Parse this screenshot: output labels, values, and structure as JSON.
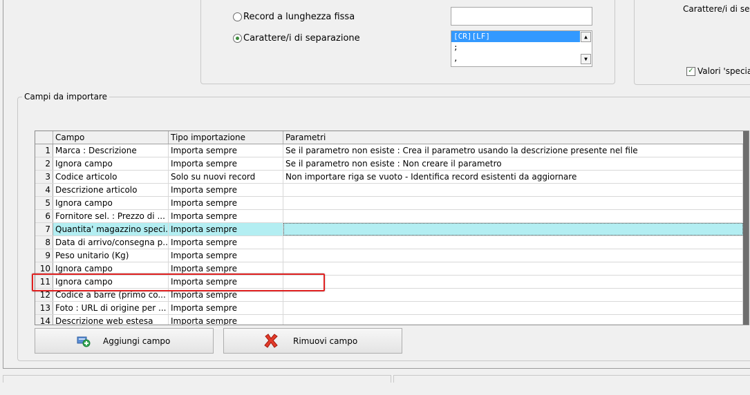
{
  "record_type": {
    "options": [
      {
        "label": "Record a lunghezza fissa",
        "selected": false
      },
      {
        "label": "Carattere/i di separazione",
        "selected": true
      }
    ],
    "fixed_length_value": "",
    "separator_list": [
      "[CR][LF]",
      ";",
      ","
    ]
  },
  "right_panel": {
    "separator_label": "Carattere/i di sep",
    "special_values_label": "Valori 'specia",
    "special_values_checked": true
  },
  "fields_group": {
    "title": "Campi da importare",
    "columns": [
      "Campo",
      "Tipo importazione",
      "Parametri"
    ],
    "rows": [
      {
        "n": "1",
        "campo": "Marca : Descrizione",
        "tipo": "Importa sempre",
        "parametri": "Se il parametro non esiste : Crea il parametro usando la descrizione presente nel file"
      },
      {
        "n": "2",
        "campo": "Ignora campo",
        "tipo": "Importa sempre",
        "parametri": "Se il parametro non esiste : Non creare il parametro"
      },
      {
        "n": "3",
        "campo": "Codice articolo",
        "tipo": "Solo su nuovi record",
        "parametri": "Non importare riga se vuoto - Identifica record esistenti da aggiornare"
      },
      {
        "n": "4",
        "campo": "Descrizione articolo",
        "tipo": "Importa sempre",
        "parametri": ""
      },
      {
        "n": "5",
        "campo": "Ignora campo",
        "tipo": "Importa sempre",
        "parametri": ""
      },
      {
        "n": "6",
        "campo": "Fornitore sel. : Prezzo di ...",
        "tipo": "Importa sempre",
        "parametri": ""
      },
      {
        "n": "7",
        "campo": "Quantita' magazzino speci...",
        "tipo": "Importa sempre",
        "parametri": ""
      },
      {
        "n": "8",
        "campo": "Data di arrivo/consegna p...",
        "tipo": "Importa sempre",
        "parametri": ""
      },
      {
        "n": "9",
        "campo": "Peso unitario (Kg)",
        "tipo": "Importa sempre",
        "parametri": ""
      },
      {
        "n": "10",
        "campo": "Ignora campo",
        "tipo": "Importa sempre",
        "parametri": ""
      },
      {
        "n": "11",
        "campo": "Ignora campo",
        "tipo": "Importa sempre",
        "parametri": ""
      },
      {
        "n": "12",
        "campo": "Codice a barre (primo co...",
        "tipo": "Importa sempre",
        "parametri": ""
      },
      {
        "n": "13",
        "campo": "Foto : URL di origine per ...",
        "tipo": "Importa sempre",
        "parametri": ""
      },
      {
        "n": "14",
        "campo": "Descrizione web estesa",
        "tipo": "Importa sempre",
        "parametri": ""
      }
    ],
    "selected_row": "7",
    "highlighted_row": "11",
    "highlight_color": "#e02020"
  },
  "buttons": {
    "add": {
      "label": "Aggiungi campo",
      "icon": "add-field-icon"
    },
    "remove": {
      "label": "Rimuovi campo",
      "icon": "red-x-icon"
    }
  }
}
